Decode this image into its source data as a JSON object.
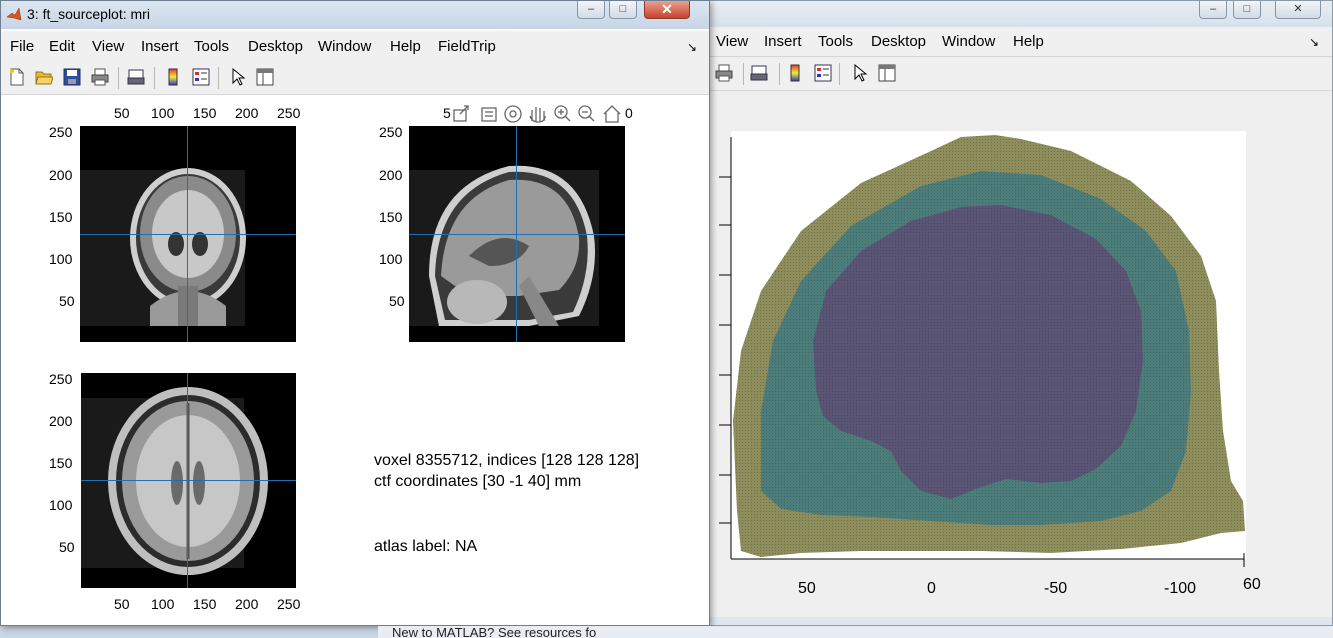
{
  "front_window": {
    "title": "3: ft_sourceplot: mri",
    "menu": [
      "File",
      "Edit",
      "View",
      "Insert",
      "Tools",
      "Desktop",
      "Window",
      "Help",
      "FieldTrip"
    ],
    "toolbar_icons": [
      "new-file-icon",
      "open-folder-icon",
      "save-icon",
      "print-icon",
      "print-preview-icon",
      "colorbar-icon",
      "legend-icon",
      "pointer-icon",
      "property-inspector-icon"
    ],
    "axes_toolbar_icons": [
      "export-icon",
      "brush-icon",
      "rotate-3d-icon",
      "pan-icon",
      "zoom-in-icon",
      "zoom-out-icon",
      "home-icon"
    ],
    "coronal": {
      "xticks": [
        "50",
        "100",
        "150",
        "200",
        "250"
      ],
      "yticks": [
        "250",
        "200",
        "150",
        "100",
        "50"
      ]
    },
    "sagittal": {
      "yticks": [
        "250",
        "200",
        "150",
        "100",
        "50"
      ],
      "xtick_fragments": [
        "5",
        "0"
      ]
    },
    "axial": {
      "xticks": [
        "50",
        "100",
        "150",
        "200",
        "250"
      ],
      "yticks": [
        "250",
        "200",
        "150",
        "100",
        "50"
      ]
    },
    "info": {
      "voxel": "voxel 8355712, indices [128 128 128]",
      "coords": "ctf coordinates [30 -1 40] mm",
      "atlas": "atlas label: NA"
    }
  },
  "back_window": {
    "menu": [
      "View",
      "Insert",
      "Tools",
      "Desktop",
      "Window",
      "Help"
    ],
    "toolbar_icons": [
      "print-icon",
      "print-preview-icon",
      "colorbar-icon",
      "legend-icon",
      "pointer-icon",
      "property-inspector-icon"
    ],
    "xticks": [
      "50",
      "0",
      "-50",
      "-100"
    ],
    "zlabel_fragment": "60",
    "colors": {
      "outer": "#8f8f5a",
      "middle": "#4f7f7b",
      "inner": "#5b5677"
    }
  },
  "status": {
    "text": "New to MATLAB? See resources fo"
  }
}
